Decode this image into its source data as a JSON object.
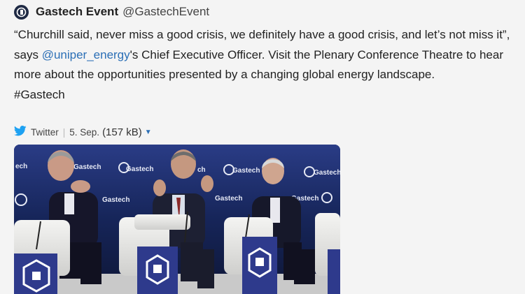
{
  "tweet": {
    "display_name": "Gastech Event",
    "handle": "@GastechEvent",
    "text_before_mention": "“Churchill said, never miss a good crisis, we definitely have a good crisis, and let’s not miss it”, says ",
    "mention": "@uniper_energy",
    "text_after_mention": "'s Chief Executive Officer. Visit the Plenary Conference Theatre to hear more about the opportunities presented by a changing global energy landscape.",
    "hashtag": "#Gastech"
  },
  "meta": {
    "source": "Twitter",
    "separator": "|",
    "date": "5. Sep.",
    "size": "(157 kB)"
  },
  "photo": {
    "backdrop_labels": [
      "ech",
      "Gastech",
      "Gastech",
      "ch",
      "Gastech",
      "Gastech",
      "Gastech",
      "Gastech",
      "Gastech"
    ]
  },
  "icons": {
    "avatar": "gastech-logo-icon",
    "bird": "twitter-bird-icon",
    "caret": "caret-down-icon"
  },
  "colors": {
    "mention": "#2b6fb6",
    "twitter_blue": "#1da1f2",
    "backdrop": "#1b2c66",
    "podium": "#2e3a8c"
  }
}
